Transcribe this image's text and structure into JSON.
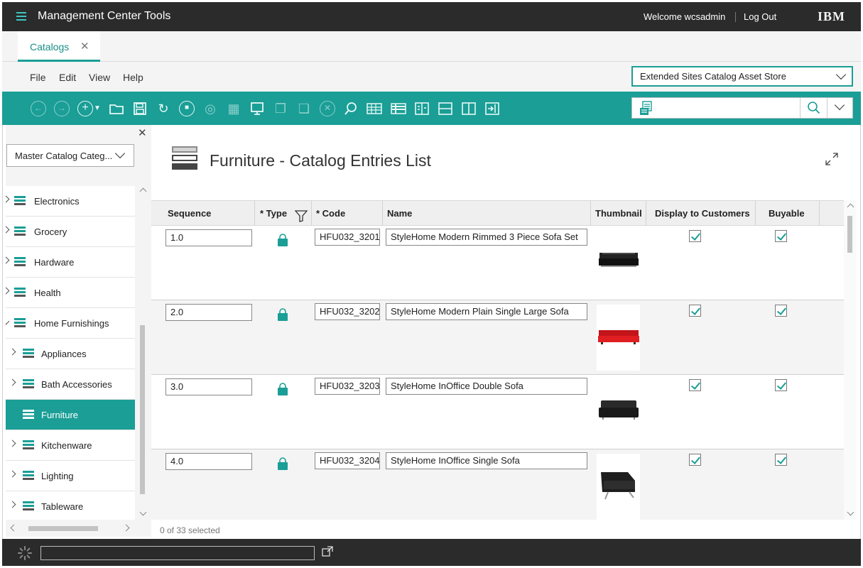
{
  "header": {
    "app_title": "Management Center Tools",
    "welcome": "Welcome wcsadmin",
    "logout": "Log Out",
    "brand": "IBM"
  },
  "tabs": [
    {
      "label": "Catalogs",
      "close": "✕",
      "active": true
    }
  ],
  "menu": {
    "items": [
      "File",
      "Edit",
      "View",
      "Help"
    ],
    "store_selector": "Extended Sites Catalog Asset Store"
  },
  "toolbar": {
    "icons": [
      "back-icon",
      "forward-icon",
      "new-icon",
      "open-icon",
      "save-icon",
      "refresh-icon",
      "stop-icon",
      "globe-icon",
      "grid-icon",
      "preview-icon",
      "copy-icon",
      "paste-icon",
      "delete-icon",
      "find-icon",
      "table-icon",
      "table-edit-icon",
      "compare-icon",
      "split-horizontal-icon",
      "split-vertical-icon",
      "collapse-icon"
    ],
    "search_value": ""
  },
  "left_panel": {
    "close": "✕",
    "catalog_select": "Master Catalog Categ...",
    "tree": [
      {
        "label": "Electronics",
        "level": 0,
        "selected": false
      },
      {
        "label": "Grocery",
        "level": 0,
        "selected": false
      },
      {
        "label": "Hardware",
        "level": 0,
        "selected": false
      },
      {
        "label": "Health",
        "level": 0,
        "selected": false
      },
      {
        "label": "Home Furnishings",
        "level": 0,
        "selected": false,
        "expanded": true
      },
      {
        "label": "Appliances",
        "level": 1,
        "selected": false
      },
      {
        "label": "Bath Accessories",
        "level": 1,
        "selected": false
      },
      {
        "label": "Furniture",
        "level": 1,
        "selected": true
      },
      {
        "label": "Kitchenware",
        "level": 1,
        "selected": false
      },
      {
        "label": "Lighting",
        "level": 1,
        "selected": false
      },
      {
        "label": "Tableware",
        "level": 1,
        "selected": false
      }
    ]
  },
  "main": {
    "title": "Furniture - Catalog Entries List",
    "columns": [
      "Sequence",
      "* Type",
      "* Code",
      "Name",
      "Thumbnail",
      "Display to Customers",
      "Buyable"
    ],
    "rows": [
      {
        "sequence": "1.0",
        "code": "HFU032_3201",
        "name": "StyleHome Modern Rimmed 3 Piece Sofa Set",
        "thumbnail": "black sofa",
        "display": true,
        "buyable": true
      },
      {
        "sequence": "2.0",
        "code": "HFU032_3202",
        "name": "StyleHome Modern Plain Single Large Sofa",
        "thumbnail": "red sofa",
        "display": true,
        "buyable": true
      },
      {
        "sequence": "3.0",
        "code": "HFU032_3203",
        "name": "StyleHome InOffice Double Sofa",
        "thumbnail": "black loveseat",
        "display": true,
        "buyable": true
      },
      {
        "sequence": "4.0",
        "code": "HFU032_3204",
        "name": "StyleHome InOffice Single Sofa",
        "thumbnail": "black armchair",
        "display": true,
        "buyable": true
      }
    ],
    "selection_status": "0 of 33 selected"
  },
  "colors": {
    "accent": "#1a9e96",
    "header_bg": "#2b2b2b",
    "panel_bg": "#f4f4f4"
  }
}
